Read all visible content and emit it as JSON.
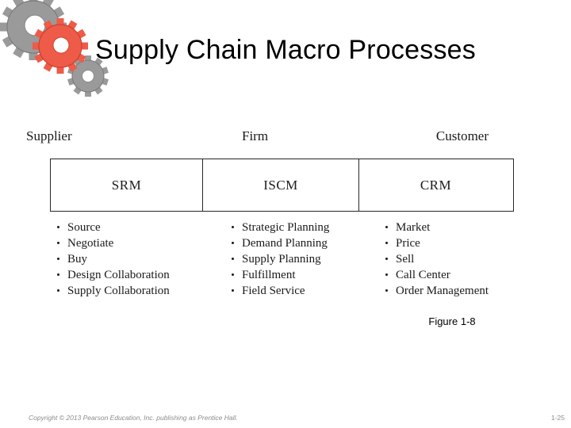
{
  "slide": {
    "title": "Supply Chain Macro Processes",
    "decoration_icon": "gears-icon",
    "gear_colors": {
      "gray": "#9a9a9a",
      "gray_dark": "#6e6e6e",
      "red": "#ee5b48",
      "red_dark": "#c9422f"
    }
  },
  "figure": {
    "caption": "Figure 1-8",
    "axis_labels": {
      "left": "Supplier",
      "middle": "Firm",
      "right": "Customer"
    },
    "columns": [
      {
        "key": "srm",
        "header": "SRM",
        "items": [
          "Source",
          "Negotiate",
          "Buy",
          "Design Collaboration",
          "Supply Collaboration"
        ]
      },
      {
        "key": "iscm",
        "header": "ISCM",
        "items": [
          "Strategic Planning",
          "Demand Planning",
          "Supply Planning",
          "Fulfillment",
          "Field Service"
        ]
      },
      {
        "key": "crm",
        "header": "CRM",
        "items": [
          "Market",
          "Price",
          "Sell",
          "Call Center",
          "Order Management"
        ]
      }
    ]
  },
  "footer": {
    "copyright": "Copyright © 2013 Pearson Education, Inc. publishing as Prentice Hall.",
    "page_number": "1-25"
  }
}
